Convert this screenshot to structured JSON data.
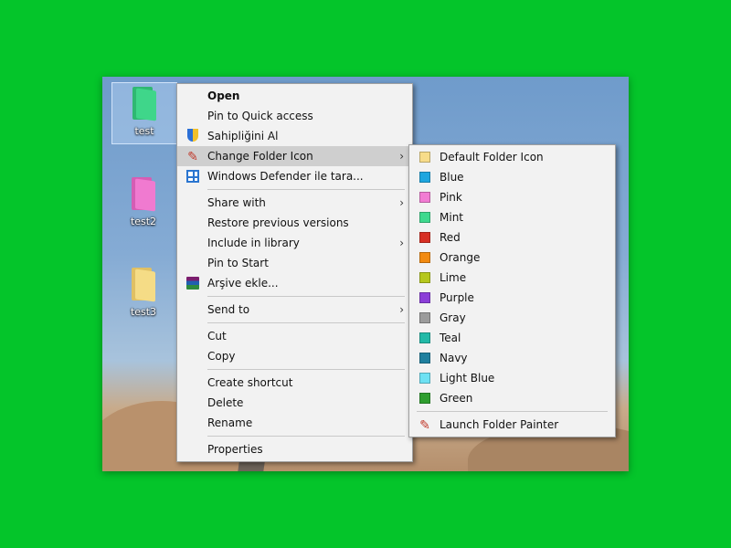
{
  "desktop": {
    "icons": [
      {
        "label": "test",
        "color": "#3fd68a"
      },
      {
        "label": "test2",
        "color": "#f07ad0"
      },
      {
        "label": "test3",
        "color": "#f5dc86"
      }
    ]
  },
  "context_menu": {
    "items": [
      {
        "label": "Open",
        "bold": true
      },
      {
        "label": "Pin to Quick access"
      },
      {
        "label": "Sahipliğini Al",
        "icon": "uac-shield-icon"
      },
      {
        "label": "Change Folder Icon",
        "icon": "paintbrush-icon",
        "has_submenu": true,
        "highlighted": true
      },
      {
        "label": "Windows Defender ile tara...",
        "icon": "windows-defender-icon"
      },
      {
        "label": "Share with",
        "has_submenu": true
      },
      {
        "label": "Restore previous versions"
      },
      {
        "label": "Include in library",
        "has_submenu": true
      },
      {
        "label": "Pin to Start"
      },
      {
        "label": "Arşive ekle...",
        "icon": "winrar-icon"
      },
      {
        "label": "Send to",
        "has_submenu": true
      },
      {
        "label": "Cut"
      },
      {
        "label": "Copy"
      },
      {
        "label": "Create shortcut"
      },
      {
        "label": "Delete"
      },
      {
        "label": "Rename"
      },
      {
        "label": "Properties"
      }
    ],
    "arrow_glyph": "›"
  },
  "submenu": {
    "colors": [
      {
        "label": "Default Folder Icon",
        "color": "#f7dc8a"
      },
      {
        "label": "Blue",
        "color": "#1ea6df"
      },
      {
        "label": "Pink",
        "color": "#f27cd3"
      },
      {
        "label": "Mint",
        "color": "#3ed98e"
      },
      {
        "label": "Red",
        "color": "#d72f23"
      },
      {
        "label": "Orange",
        "color": "#f28a10"
      },
      {
        "label": "Lime",
        "color": "#b5c71d"
      },
      {
        "label": "Purple",
        "color": "#8b3ed8"
      },
      {
        "label": "Gray",
        "color": "#9b9b9b"
      },
      {
        "label": "Teal",
        "color": "#22b9a7"
      },
      {
        "label": "Navy",
        "color": "#1f7f9e"
      },
      {
        "label": "Light Blue",
        "color": "#6ee1f3"
      },
      {
        "label": "Green",
        "color": "#2f9e2f"
      }
    ],
    "launch_label": "Launch Folder Painter"
  }
}
